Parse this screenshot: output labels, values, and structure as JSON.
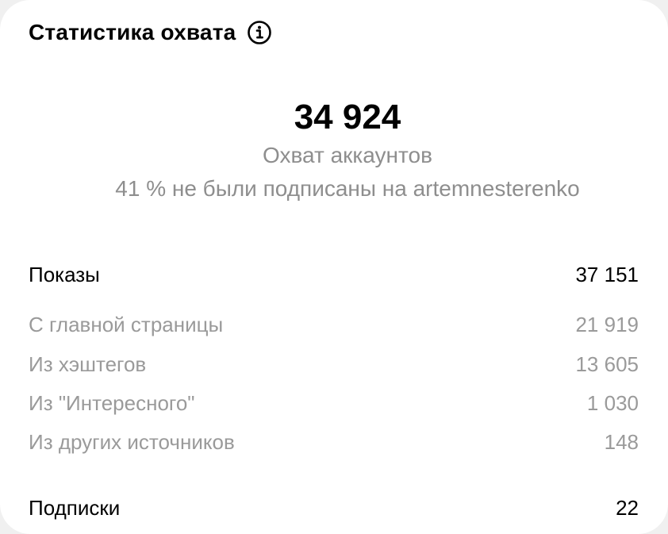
{
  "card": {
    "title": "Статистика охвата",
    "info_icon": "info-circle-icon"
  },
  "summary": {
    "accounts_reached": "34 924",
    "accounts_reached_label": "Охват аккаунтов",
    "non_followers_note": "41 % не были подписаны на artemnesterenko"
  },
  "impressions": {
    "label": "Показы",
    "value": "37 151",
    "breakdown": [
      {
        "label": "С главной страницы",
        "value": "21 919"
      },
      {
        "label": "Из хэштегов",
        "value": "13 605"
      },
      {
        "label": "Из \"Интересного\"",
        "value": "1 030"
      },
      {
        "label": "Из других источников",
        "value": "148"
      }
    ]
  },
  "follows": {
    "label": "Подписки",
    "value": "22"
  },
  "colors": {
    "primary_text": "#000000",
    "secondary_text": "#8e8e8e",
    "background": "#ffffff"
  }
}
